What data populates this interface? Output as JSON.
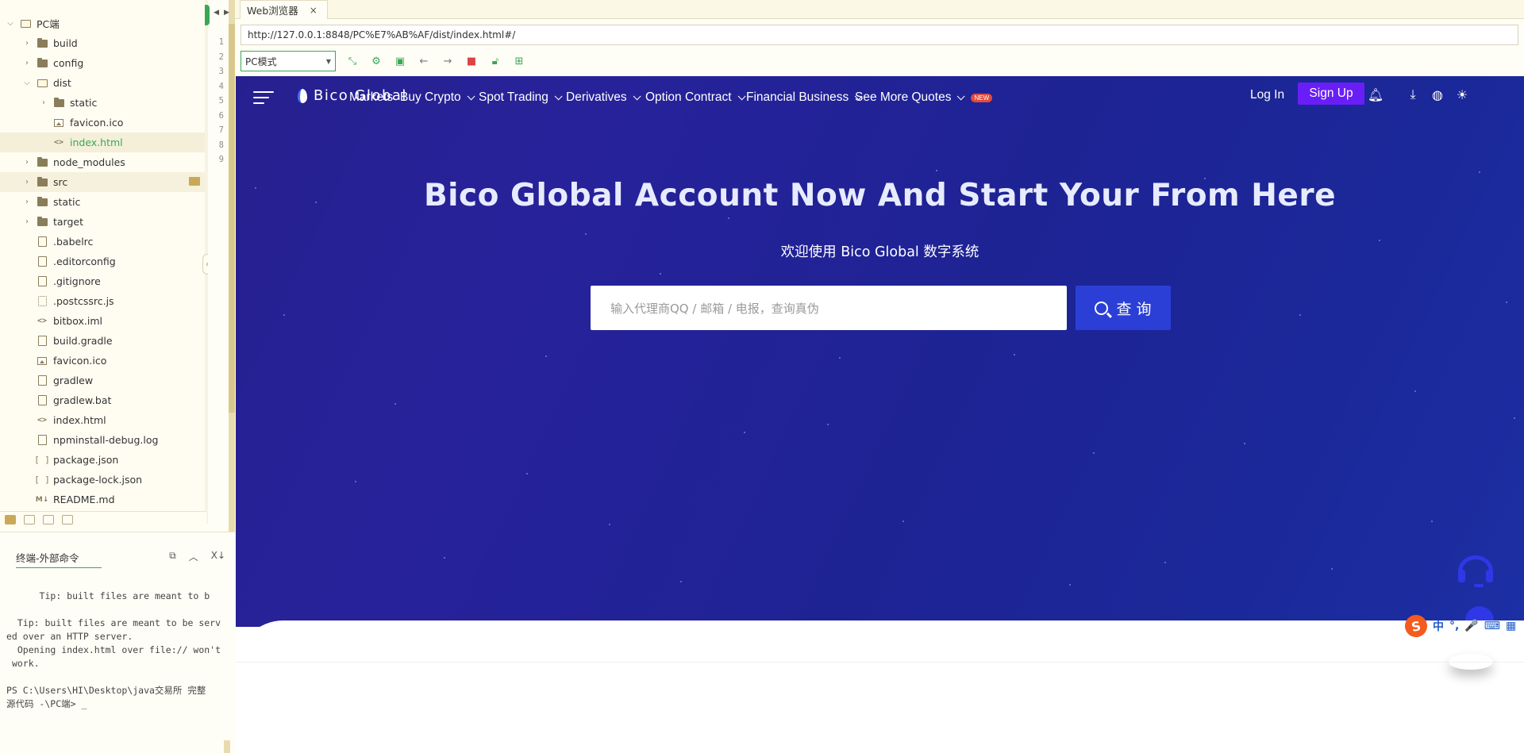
{
  "tree": {
    "items": [
      {
        "label": "PC端",
        "depth": 0,
        "kind": "folder-open",
        "chev": "v"
      },
      {
        "label": "build",
        "depth": 1,
        "kind": "folder",
        "chev": ">"
      },
      {
        "label": "config",
        "depth": 1,
        "kind": "folder",
        "chev": ">"
      },
      {
        "label": "dist",
        "depth": 1,
        "kind": "folder-open",
        "chev": "v"
      },
      {
        "label": "static",
        "depth": 2,
        "kind": "folder",
        "chev": ">"
      },
      {
        "label": "favicon.ico",
        "depth": 2,
        "kind": "image",
        "chev": ""
      },
      {
        "label": "index.html",
        "depth": 2,
        "kind": "code",
        "chev": "",
        "selected": true
      },
      {
        "label": "node_modules",
        "depth": 1,
        "kind": "folder",
        "chev": ">"
      },
      {
        "label": "src",
        "depth": 1,
        "kind": "folder",
        "chev": ">",
        "hover": true
      },
      {
        "label": "static",
        "depth": 1,
        "kind": "folder",
        "chev": ">"
      },
      {
        "label": "target",
        "depth": 1,
        "kind": "folder",
        "chev": ">"
      },
      {
        "label": ".babelrc",
        "depth": 1,
        "kind": "file",
        "chev": ""
      },
      {
        "label": ".editorconfig",
        "depth": 1,
        "kind": "file",
        "chev": ""
      },
      {
        "label": ".gitignore",
        "depth": 1,
        "kind": "file",
        "chev": ""
      },
      {
        "label": ".postcssrc.js",
        "depth": 1,
        "kind": "js",
        "chev": ""
      },
      {
        "label": "bitbox.iml",
        "depth": 1,
        "kind": "code",
        "chev": ""
      },
      {
        "label": "build.gradle",
        "depth": 1,
        "kind": "file",
        "chev": ""
      },
      {
        "label": "favicon.ico",
        "depth": 1,
        "kind": "image",
        "chev": ""
      },
      {
        "label": "gradlew",
        "depth": 1,
        "kind": "file",
        "chev": ""
      },
      {
        "label": "gradlew.bat",
        "depth": 1,
        "kind": "file",
        "chev": ""
      },
      {
        "label": "index.html",
        "depth": 1,
        "kind": "code",
        "chev": ""
      },
      {
        "label": "npminstall-debug.log",
        "depth": 1,
        "kind": "file",
        "chev": ""
      },
      {
        "label": "package.json",
        "depth": 1,
        "kind": "json",
        "chev": ""
      },
      {
        "label": "package-lock.json",
        "depth": 1,
        "kind": "json",
        "chev": ""
      },
      {
        "label": "README.md",
        "depth": 1,
        "kind": "md",
        "chev": ""
      }
    ]
  },
  "gutter": {
    "line_numbers": [
      "1",
      "2",
      "3",
      "4",
      "5",
      "6",
      "7",
      "8",
      "9"
    ]
  },
  "terminal": {
    "tab_label": "终端-外部命令",
    "lines": "      Tip: built files are meant to b\n\n  Tip: built files are meant to be serv\ned over an HTTP server.\n  Opening index.html over file:// won't\n work.\n\nPS C:\\Users\\HI\\Desktop\\java交易所 完整\n源代码 -\\PC端> _"
  },
  "browser": {
    "tab_label": "Web浏览器",
    "tab_close": "×",
    "url": "http://127.0.0.1:8848/PC%E7%AB%AF/dist/index.html#/",
    "mode": "PC模式"
  },
  "site": {
    "logo_text": "Bico Global",
    "nav": {
      "markets": "Markets",
      "buy_crypto": "Buy Crypto",
      "spot_trading": "Spot Trading",
      "derivatives": "Derivatives",
      "option_contract": "Option Contract",
      "financial_business": "Financial Business",
      "see_more_quotes": "See More Quotes",
      "new_badge": "NEW",
      "login": "Log In",
      "signup": "Sign Up"
    },
    "hero_title": "Bico Global Account Now And Start Your From Here",
    "hero_subtitle": "欢迎使用 Bico Global 数字系统",
    "search_placeholder": "输入代理商QQ / 邮箱 / 电报，查询真伪",
    "search_button": "查 询"
  },
  "ime": {
    "logo": "S",
    "items": [
      "中",
      "°,",
      "🎤",
      "⌨",
      "▦"
    ]
  },
  "colors": {
    "accent_green": "#3aa757",
    "signup_purple": "#6a1ef7",
    "search_button_blue": "#2b3fd6",
    "hero_bg": "#24209a"
  }
}
